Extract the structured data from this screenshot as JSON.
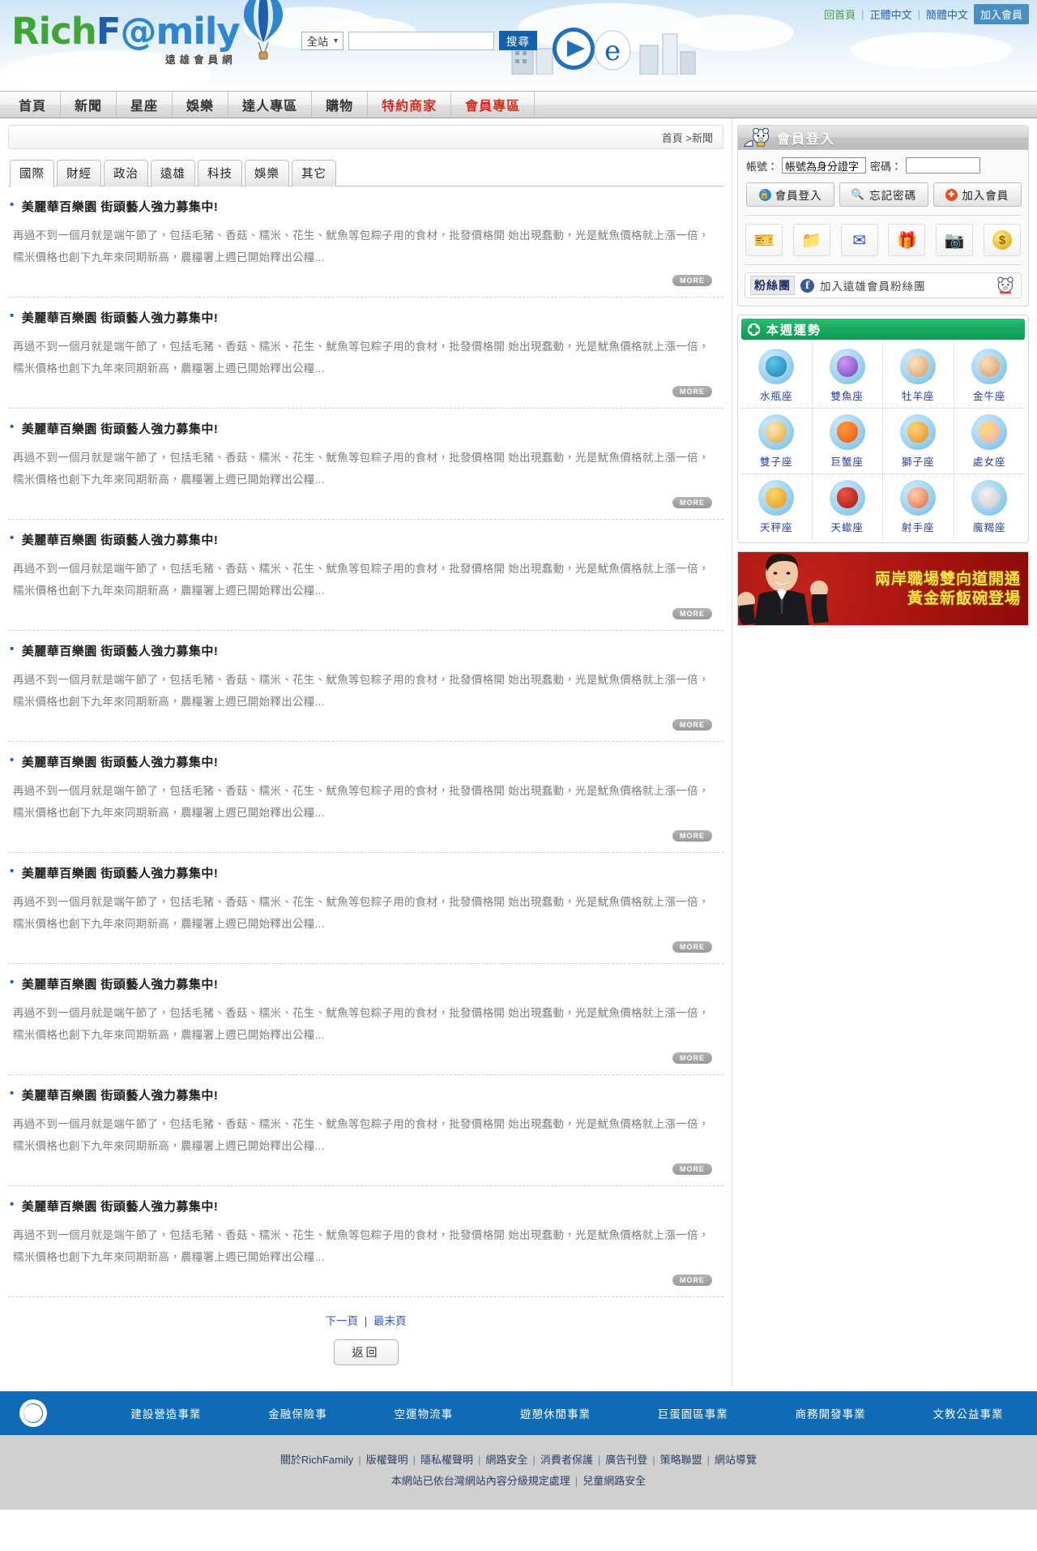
{
  "header": {
    "logo_rich": "Rich",
    "logo_f": "F",
    "logo_at": "@",
    "logo_mily": "mily",
    "logo_sub": "遠雄會員網",
    "links": {
      "home": "回首頁",
      "traditional": "正體中文",
      "simplified": "簡體中文",
      "join": "加入會員",
      "separator": "|"
    },
    "search": {
      "scope_label": "全站",
      "chevron": "chevron-down",
      "input_value": "",
      "input_placeholder": "",
      "button_label": "搜尋"
    }
  },
  "nav": {
    "items": [
      {
        "label": "首頁",
        "accent": false
      },
      {
        "label": "新聞",
        "accent": false
      },
      {
        "label": "星座",
        "accent": false
      },
      {
        "label": "娛樂",
        "accent": false
      },
      {
        "label": "達人專區",
        "accent": false
      },
      {
        "label": "購物",
        "accent": false
      },
      {
        "label": "特約商家",
        "accent": true
      },
      {
        "label": "會員專區",
        "accent": true
      }
    ]
  },
  "main": {
    "breadcrumb": "首頁 >新聞",
    "tabs": [
      {
        "label": "國際",
        "active": true
      },
      {
        "label": "財經",
        "active": false
      },
      {
        "label": "政治",
        "active": false
      },
      {
        "label": "遠雄",
        "active": false
      },
      {
        "label": "科技",
        "active": false
      },
      {
        "label": "娛樂",
        "active": false
      },
      {
        "label": "其它",
        "active": false
      }
    ],
    "news_title": "美麗華百樂園 街頭藝人強力募集中!",
    "news_body": "再過不到一個月就是端午節了，包括毛豬、香菇、糯米、花生、魷魚等包粽子用的食材，批發價格開 始出現蠢動，光是魷魚價格就上漲一倍，糯米價格也創下九年來同期新高，農糧署上週已開始釋出公糧...",
    "more_label": "MORE",
    "news_count": 10,
    "pager": {
      "next": "下一頁",
      "separator": "|",
      "last": "最末頁"
    },
    "back_label": "返回"
  },
  "sidebar": {
    "login": {
      "title": "會員登入",
      "account_label": "帳號：",
      "account_value": "帳號為身分證字",
      "password_label": "密碼：",
      "password_value": "",
      "buttons": [
        {
          "label": "會員登入",
          "icon": "lock-icon"
        },
        {
          "label": "忘記密碼",
          "icon": "magnifier-icon"
        },
        {
          "label": "加入會員",
          "icon": "plus-icon"
        }
      ],
      "quick_icons": [
        "ticket-icon",
        "folder-mail-icon",
        "envelope-icon",
        "gift-icon",
        "camera-icon",
        "coin-icon"
      ]
    },
    "fanclub": {
      "badge": "粉絲團",
      "facebook_icon": "facebook-icon",
      "text": "加入遠雄會員粉絲團",
      "mascot": "bear-mascot-icon"
    },
    "horoscope": {
      "title": "本週運勢",
      "header_icon": "clover-icon",
      "signs": [
        {
          "name": "水瓶座",
          "icon": "aquarius-icon",
          "color1": "#5bc8e8",
          "color2": "#1b7fb8"
        },
        {
          "name": "雙魚座",
          "icon": "pisces-icon",
          "color1": "#c89bf0",
          "color2": "#7b3fc4"
        },
        {
          "name": "牡羊座",
          "icon": "aries-icon",
          "color1": "#ffe2c4",
          "color2": "#d99a5e"
        },
        {
          "name": "金牛座",
          "icon": "taurus-icon",
          "color1": "#ffdfc0",
          "color2": "#cf9a60"
        },
        {
          "name": "雙子座",
          "icon": "gemini-icon",
          "color1": "#ffe9b8",
          "color2": "#e0a23c"
        },
        {
          "name": "巨蟹座",
          "icon": "cancer-icon",
          "color1": "#ff9a3c",
          "color2": "#e25a10"
        },
        {
          "name": "獅子座",
          "icon": "leo-icon",
          "color1": "#ffd27a",
          "color2": "#e09020"
        },
        {
          "name": "處女座",
          "icon": "virgo-icon",
          "color1": "#ffe07a",
          "color2": "#f0a8c0"
        },
        {
          "name": "天秤座",
          "icon": "libra-icon",
          "color1": "#ffd66a",
          "color2": "#e09a18"
        },
        {
          "name": "天蠍座",
          "icon": "scorpio-icon",
          "color1": "#e8564a",
          "color2": "#a8140c"
        },
        {
          "name": "射手座",
          "icon": "sagittarius-icon",
          "color1": "#ffd0b0",
          "color2": "#e06a3a"
        },
        {
          "name": "魔羯座",
          "icon": "capricorn-icon",
          "color1": "#f2f2f2",
          "color2": "#c8c8c8"
        }
      ]
    },
    "ad": {
      "line1": "兩岸職場雙向道開通",
      "line2": "黃金新飯碗登場"
    }
  },
  "footer": {
    "logo": "farglory-logo",
    "nav": [
      "建設營造事業",
      "金融保險事",
      "空運物流事",
      "遊憩休閒事業",
      "巨蛋園區事業",
      "商務開發事業",
      "文教公益事業"
    ],
    "links_row1": [
      "關於RichFamily",
      "版權聲明",
      "隱私權聲明",
      "網路安全",
      "消費者保護",
      "廣告刊登",
      "策略聯盟",
      "網站導覽"
    ],
    "links_row2": [
      "本網站已依台灣網站內容分級規定處理",
      "兒童網路安全"
    ],
    "pipe": "|"
  },
  "colors": {
    "nav_accent": "#d52b1e",
    "link_blue": "#2a62b4",
    "link_green": "#4c9b3f",
    "footer_blue": "#0f6bb5",
    "horoscope_green": "#17a860",
    "join_button": "#4a8fc2",
    "search_button": "#1560ad"
  }
}
